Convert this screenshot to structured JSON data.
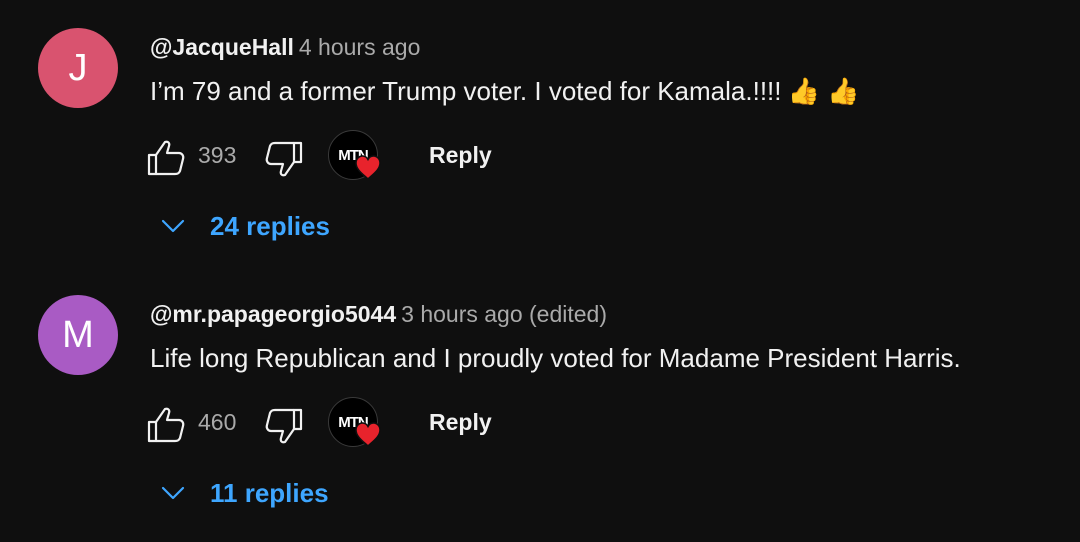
{
  "comments": [
    {
      "avatar_letter": "J",
      "avatar_color": "#d9536f",
      "author": "@JacqueHall",
      "time": "4 hours ago",
      "text": "I’m 79 and a former Trump voter. I voted for Kamala.!!!!",
      "emoji": "👍 👍",
      "likes": "393",
      "creator_badge": "MTN",
      "reply_label": "Reply",
      "replies_label": "24 replies"
    },
    {
      "avatar_letter": "M",
      "avatar_color": "#a95bc4",
      "author": "@mr.papageorgio5044",
      "time": "3 hours ago (edited)",
      "text": "Life long Republican and I proudly voted for Madame President Harris.",
      "emoji": "",
      "likes": "460",
      "creator_badge": "MTN",
      "reply_label": "Reply",
      "replies_label": "11 replies"
    }
  ],
  "colors": {
    "background": "#0f0f0f",
    "text_primary": "#f1f1f1",
    "text_secondary": "#aaaaaa",
    "link_blue": "#3ea6ff",
    "heart_red": "#e8232c"
  },
  "icons": {
    "like": "thumbs-up-icon",
    "dislike": "thumbs-down-icon",
    "heart": "heart-icon",
    "chevron": "chevron-down-icon"
  }
}
